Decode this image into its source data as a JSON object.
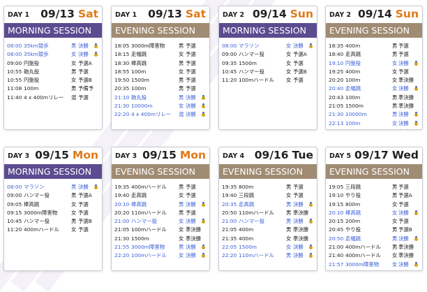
{
  "colors": {
    "morning": "#5b4b90",
    "evening": "#a08b73",
    "highlight": "#3a5ed6",
    "saturday": "#e07a18",
    "sunday": "#e07a18",
    "monday": "#e07a18",
    "weekday": "#222222",
    "medal": "#d3a21a"
  },
  "medal_icon": "medal-icon",
  "cards": [
    {
      "day": "DAY 1",
      "date": "09/13",
      "weekday": "Sat",
      "wd_color": "saturday",
      "session": "MORNING SESSION",
      "type": "morning",
      "rows": [
        {
          "time": "08:00",
          "event": "35km競歩",
          "gender": "男",
          "round": "決勝",
          "medal": true,
          "hl": true
        },
        {
          "time": "08:00",
          "event": "35km競歩",
          "gender": "女",
          "round": "決勝",
          "medal": true,
          "hl": true
        },
        {
          "time": "09:00",
          "event": "円盤投",
          "gender": "女",
          "round": "予選A",
          "medal": false,
          "hl": false
        },
        {
          "time": "10:55",
          "event": "砲丸投",
          "gender": "男",
          "round": "予選",
          "medal": false,
          "hl": false
        },
        {
          "time": "10:55",
          "event": "円盤投",
          "gender": "女",
          "round": "予選B",
          "medal": false,
          "hl": false
        },
        {
          "time": "11:08",
          "event": "100m",
          "gender": "男",
          "round": "予備予",
          "medal": false,
          "hl": false
        },
        {
          "time": "11:40",
          "event": "4 x 400mリレー",
          "gender": "混",
          "round": "予選",
          "medal": false,
          "hl": false
        }
      ]
    },
    {
      "day": "DAY 1",
      "date": "09/13",
      "weekday": "Sat",
      "wd_color": "saturday",
      "session": "EVENING SESSION",
      "type": "evening",
      "rows": [
        {
          "time": "18:05",
          "event": "3000m障害物",
          "gender": "男",
          "round": "予選",
          "medal": false,
          "hl": false
        },
        {
          "time": "18:15",
          "event": "走幅跳",
          "gender": "女",
          "round": "予選",
          "medal": false,
          "hl": false
        },
        {
          "time": "18:30",
          "event": "棒高跳",
          "gender": "男",
          "round": "予選",
          "medal": false,
          "hl": false
        },
        {
          "time": "18:55",
          "event": "100m",
          "gender": "女",
          "round": "予選",
          "medal": false,
          "hl": false
        },
        {
          "time": "19:50",
          "event": "1500m",
          "gender": "男",
          "round": "予選",
          "medal": false,
          "hl": false
        },
        {
          "time": "20:35",
          "event": "100m",
          "gender": "男",
          "round": "予選",
          "medal": false,
          "hl": false
        },
        {
          "time": "21:10",
          "event": "砲丸投",
          "gender": "男",
          "round": "決勝",
          "medal": true,
          "hl": true
        },
        {
          "time": "21:30",
          "event": "10000m",
          "gender": "女",
          "round": "決勝",
          "medal": true,
          "hl": true
        },
        {
          "time": "22:20",
          "event": "4 x 400mリレー",
          "gender": "混",
          "round": "決勝",
          "medal": true,
          "hl": true
        }
      ]
    },
    {
      "day": "DAY 2",
      "date": "09/14",
      "weekday": "Sun",
      "wd_color": "sunday",
      "session": "MORNING SESSION",
      "type": "morning",
      "rows": [
        {
          "time": "08:00",
          "event": "マラソン",
          "gender": "女",
          "round": "決勝",
          "medal": true,
          "hl": true
        },
        {
          "time": "09:00",
          "event": "ハンマー投",
          "gender": "女",
          "round": "予選A",
          "medal": false,
          "hl": false
        },
        {
          "time": "09:35",
          "event": "1500m",
          "gender": "女",
          "round": "予選",
          "medal": false,
          "hl": false
        },
        {
          "time": "10:45",
          "event": "ハンマー投",
          "gender": "女",
          "round": "予選B",
          "medal": false,
          "hl": false
        },
        {
          "time": "11:20",
          "event": "100mハードル",
          "gender": "女",
          "round": "予選",
          "medal": false,
          "hl": false
        }
      ]
    },
    {
      "day": "DAY 2",
      "date": "09/14",
      "weekday": "Sun",
      "wd_color": "sunday",
      "session": "EVENING SESSION",
      "type": "evening",
      "rows": [
        {
          "time": "18:35",
          "event": "400m",
          "gender": "男",
          "round": "予選",
          "medal": false,
          "hl": false
        },
        {
          "time": "18:40",
          "event": "走高跳",
          "gender": "男",
          "round": "予選",
          "medal": false,
          "hl": false
        },
        {
          "time": "19:10",
          "event": "円盤投",
          "gender": "女",
          "round": "決勝",
          "medal": true,
          "hl": true
        },
        {
          "time": "19:25",
          "event": "400m",
          "gender": "女",
          "round": "予選",
          "medal": false,
          "hl": false
        },
        {
          "time": "20:20",
          "event": "100m",
          "gender": "女",
          "round": "準決勝",
          "medal": false,
          "hl": false
        },
        {
          "time": "20:40",
          "event": "走幅跳",
          "gender": "女",
          "round": "決勝",
          "medal": true,
          "hl": true
        },
        {
          "time": "20:43",
          "event": "100m",
          "gender": "男",
          "round": "準決勝",
          "medal": false,
          "hl": false
        },
        {
          "time": "21:05",
          "event": "1500m",
          "gender": "男",
          "round": "準決勝",
          "medal": false,
          "hl": false
        },
        {
          "time": "21:30",
          "event": "10000m",
          "gender": "男",
          "round": "決勝",
          "medal": true,
          "hl": true
        },
        {
          "time": "22:13",
          "event": "100m",
          "gender": "女",
          "round": "決勝",
          "medal": true,
          "hl": true
        },
        {
          "time": "22:20",
          "event": "100m",
          "gender": "男",
          "round": "決勝",
          "medal": true,
          "hl": true
        }
      ]
    },
    {
      "day": "DAY 3",
      "date": "09/15",
      "weekday": "Mon",
      "wd_color": "monday",
      "session": "MORNING SESSION",
      "type": "morning",
      "rows": [
        {
          "time": "08:00",
          "event": "マラソン",
          "gender": "男",
          "round": "決勝",
          "medal": true,
          "hl": true
        },
        {
          "time": "09:00",
          "event": "ハンマー投",
          "gender": "男",
          "round": "予選A",
          "medal": false,
          "hl": false
        },
        {
          "time": "09:05",
          "event": "棒高跳",
          "gender": "女",
          "round": "予選",
          "medal": false,
          "hl": false
        },
        {
          "time": "09:15",
          "event": "3000m障害物",
          "gender": "女",
          "round": "予選",
          "medal": false,
          "hl": false
        },
        {
          "time": "10:45",
          "event": "ハンマー投",
          "gender": "男",
          "round": "予選B",
          "medal": false,
          "hl": false
        },
        {
          "time": "11:20",
          "event": "400mハードル",
          "gender": "女",
          "round": "予選",
          "medal": false,
          "hl": false
        }
      ]
    },
    {
      "day": "DAY 3",
      "date": "09/15",
      "weekday": "Mon",
      "wd_color": "monday",
      "session": "EVENING SESSION",
      "type": "evening",
      "rows": [
        {
          "time": "19:35",
          "event": "400mハードル",
          "gender": "男",
          "round": "予選",
          "medal": false,
          "hl": false
        },
        {
          "time": "19:40",
          "event": "走高跳",
          "gender": "女",
          "round": "予選",
          "medal": false,
          "hl": false
        },
        {
          "time": "20:10",
          "event": "棒高跳",
          "gender": "男",
          "round": "決勝",
          "medal": true,
          "hl": true
        },
        {
          "time": "20:20",
          "event": "110mハードル",
          "gender": "男",
          "round": "予選",
          "medal": false,
          "hl": false
        },
        {
          "time": "21:00",
          "event": "ハンマー投",
          "gender": "女",
          "round": "決勝",
          "medal": true,
          "hl": true
        },
        {
          "time": "21:05",
          "event": "100mハードル",
          "gender": "女",
          "round": "準決勝",
          "medal": false,
          "hl": false
        },
        {
          "time": "21:30",
          "event": "1500m",
          "gender": "女",
          "round": "準決勝",
          "medal": false,
          "hl": false
        },
        {
          "time": "21:55",
          "event": "3000m障害物",
          "gender": "男",
          "round": "決勝",
          "medal": true,
          "hl": true
        },
        {
          "time": "22:20",
          "event": "100mハードル",
          "gender": "女",
          "round": "決勝",
          "medal": true,
          "hl": true
        }
      ]
    },
    {
      "day": "DAY 4",
      "date": "09/16",
      "weekday": "Tue",
      "wd_color": "weekday",
      "session": "EVENING SESSION",
      "type": "evening",
      "rows": [
        {
          "time": "19:35",
          "event": "800m",
          "gender": "男",
          "round": "予選",
          "medal": false,
          "hl": false
        },
        {
          "time": "19:40",
          "event": "三段跳",
          "gender": "女",
          "round": "予選",
          "medal": false,
          "hl": false
        },
        {
          "time": "20:35",
          "event": "走高跳",
          "gender": "男",
          "round": "決勝",
          "medal": true,
          "hl": true
        },
        {
          "time": "20:50",
          "event": "110mハードル",
          "gender": "男",
          "round": "準決勝",
          "medal": false,
          "hl": false
        },
        {
          "time": "21:00",
          "event": "ハンマー投",
          "gender": "男",
          "round": "決勝",
          "medal": true,
          "hl": true
        },
        {
          "time": "21:05",
          "event": "400m",
          "gender": "男",
          "round": "準決勝",
          "medal": false,
          "hl": false
        },
        {
          "time": "21:35",
          "event": "400m",
          "gender": "女",
          "round": "準決勝",
          "medal": false,
          "hl": false
        },
        {
          "time": "22:05",
          "event": "1500m",
          "gender": "女",
          "round": "決勝",
          "medal": true,
          "hl": true
        },
        {
          "time": "22:20",
          "event": "110mハードル",
          "gender": "男",
          "round": "決勝",
          "medal": true,
          "hl": true
        }
      ]
    },
    {
      "day": "DAY 5",
      "date": "09/17",
      "weekday": "Wed",
      "wd_color": "weekday",
      "session": "EVENING SESSION",
      "type": "evening",
      "rows": [
        {
          "time": "19:05",
          "event": "三段跳",
          "gender": "男",
          "round": "予選",
          "medal": false,
          "hl": false
        },
        {
          "time": "19:10",
          "event": "やり投",
          "gender": "男",
          "round": "予選A",
          "medal": false,
          "hl": false
        },
        {
          "time": "19:15",
          "event": "800m",
          "gender": "女",
          "round": "予選",
          "medal": false,
          "hl": false
        },
        {
          "time": "20:10",
          "event": "棒高跳",
          "gender": "女",
          "round": "決勝",
          "medal": true,
          "hl": true
        },
        {
          "time": "20:15",
          "event": "200m",
          "gender": "女",
          "round": "予選",
          "medal": false,
          "hl": false
        },
        {
          "time": "20:45",
          "event": "やり投",
          "gender": "男",
          "round": "予選B",
          "medal": false,
          "hl": false
        },
        {
          "time": "20:50",
          "event": "走幅跳",
          "gender": "男",
          "round": "決勝",
          "medal": true,
          "hl": true
        },
        {
          "time": "21:00",
          "event": "400mハードル",
          "gender": "男",
          "round": "準決勝",
          "medal": false,
          "hl": false
        },
        {
          "time": "21:40",
          "event": "400mハードル",
          "gender": "女",
          "round": "準決勝",
          "medal": false,
          "hl": false
        },
        {
          "time": "21:57",
          "event": "3000m障害物",
          "gender": "女",
          "round": "決勝",
          "medal": true,
          "hl": true
        },
        {
          "time": "22:20",
          "event": "1500m",
          "gender": "男",
          "round": "決勝",
          "medal": true,
          "hl": true
        }
      ]
    }
  ]
}
